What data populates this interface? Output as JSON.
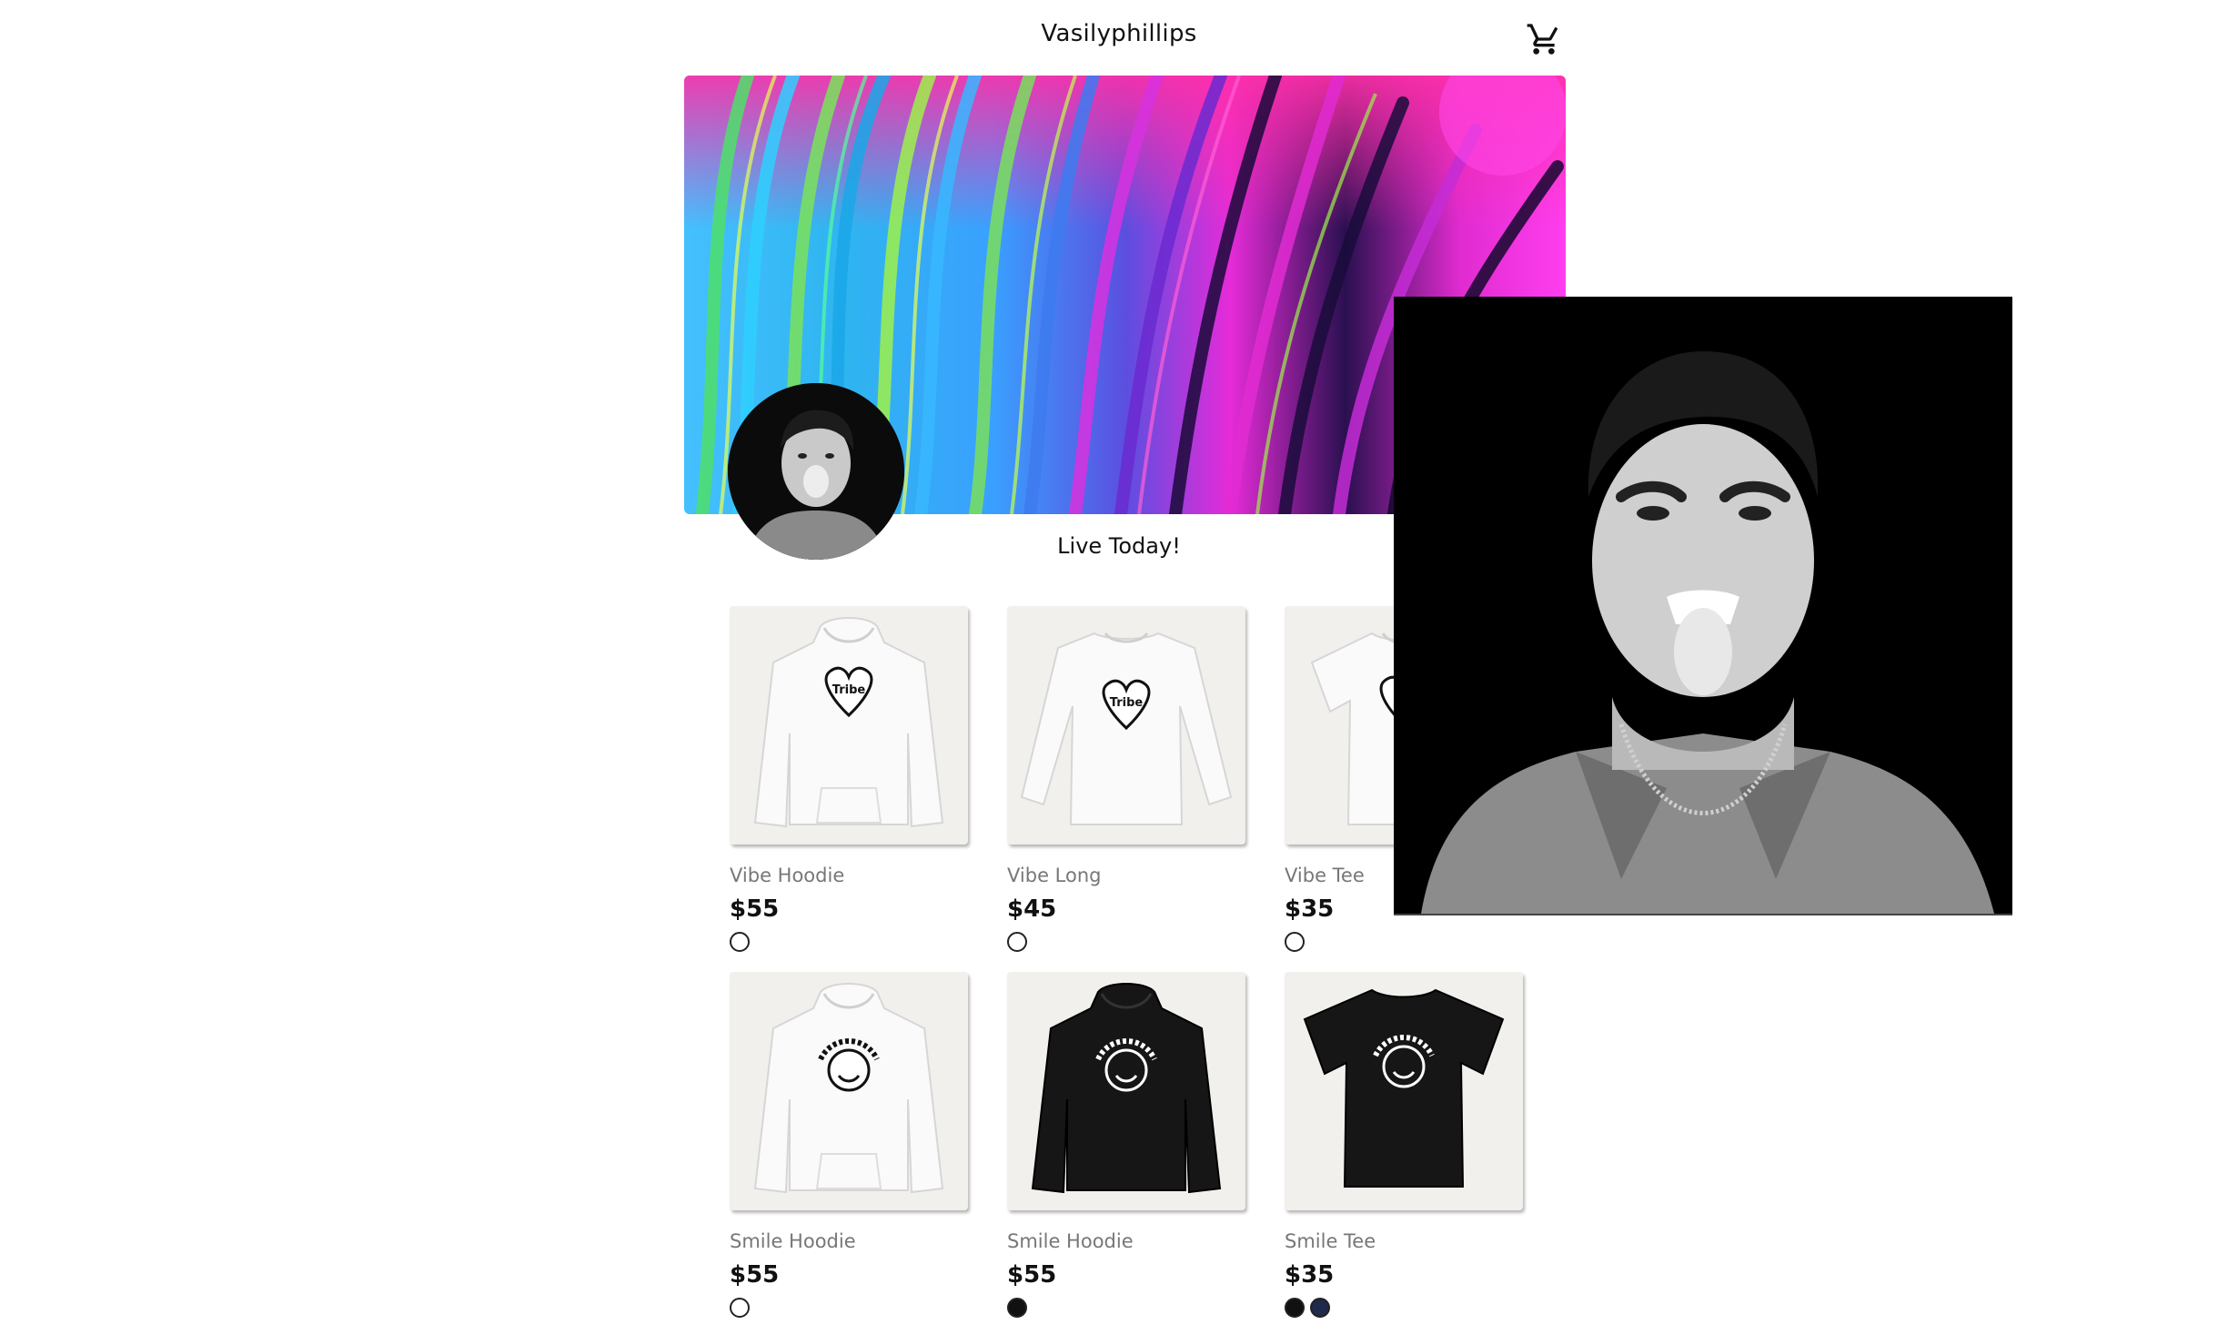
{
  "header": {
    "store_name": "Vasilyphillips",
    "cart_icon": "shopping-cart-icon"
  },
  "banner": {
    "description_icon": "abstract-fluid-art-banner"
  },
  "profile": {
    "tagline": "Live Today!"
  },
  "products": [
    {
      "name": "Vibe Hoodie",
      "price": "$55",
      "swatches": [
        "#ffffff"
      ]
    },
    {
      "name": "Vibe Long",
      "price": "$45",
      "swatches": [
        "#ffffff"
      ]
    },
    {
      "name": "Vibe Tee",
      "price": "$35",
      "swatches": [
        "#ffffff"
      ]
    },
    {
      "name": "Smile Hoodie",
      "price": "$55",
      "swatches": [
        "#ffffff"
      ]
    },
    {
      "name": "Smile Hoodie",
      "price": "$55",
      "swatches": [
        "#111111"
      ]
    },
    {
      "name": "Smile Tee",
      "price": "$35",
      "swatches": [
        "#111111",
        "#1f2a4d"
      ]
    }
  ],
  "colors": {
    "text": "#111111",
    "muted": "#777777",
    "card_bg": "#f2f0ec"
  }
}
